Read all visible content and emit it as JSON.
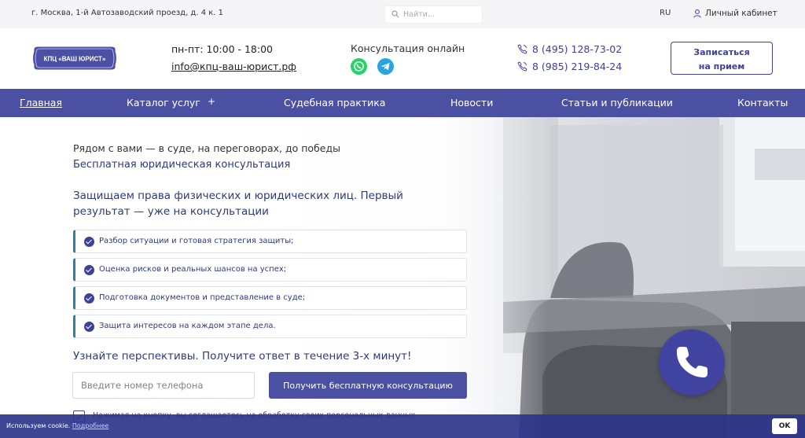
{
  "topbar": {
    "address": "г. Москва, 1-й Автозаводский проезд, д. 4 к. 1",
    "search_placeholder": "Найти...",
    "lang": "RU",
    "cabinet_label": "Личный кабинет"
  },
  "header": {
    "logo_text": "КПЦ «ВАШ ЮРИСТ»",
    "hours": "пн-пт: 10:00 - 18:00",
    "email": "info@кпц-ваш-юрист.рф",
    "consult_online": "Консультация онлайн",
    "phones": [
      "8 (495) 128-73-02",
      "8 (985) 219-84-24"
    ],
    "appoint_line1": "Записаться",
    "appoint_line2": "на прием"
  },
  "nav": {
    "items": [
      {
        "label": "Главная",
        "active": true
      },
      {
        "label": "Каталог услуг"
      },
      {
        "label": "Судебная практика"
      },
      {
        "label": "Новости"
      },
      {
        "label": "Статьи и публикации"
      },
      {
        "label": "Контакты"
      }
    ],
    "plus": "+"
  },
  "hero": {
    "tagline": "Рядом с вами — в суде, на переговорах, до победы",
    "free_consult": "Бесплатная юридическая консультация",
    "headline": "Защищаем права физических и юридических лиц. Первый результат — уже на консультации",
    "features": [
      "Разбор ситуации и готовая стратегия защиты;",
      "Оценка рисков и реальных шансов на успех;",
      "Подготовка документов и представление в суде;",
      "Защита интересов на каждом этапе дела."
    ],
    "prospects": "Узнайте перспективы. Получите ответ в течение 3-х минут!",
    "phone_placeholder": "Введите номер телефона",
    "cta_label": "Получить бесплатную консультацию",
    "agree_text": "Нажимая на кнопку, вы соглашаетесь на обработку своих персональных данных"
  },
  "cookie": {
    "text": "Используем cookie.",
    "more": "Подробнее",
    "ok": "OK"
  },
  "colors": {
    "brand": "#4b50a3",
    "accent_text": "#2e3a7a",
    "whatsapp": "#25d366",
    "telegram": "#2aa3e0"
  }
}
